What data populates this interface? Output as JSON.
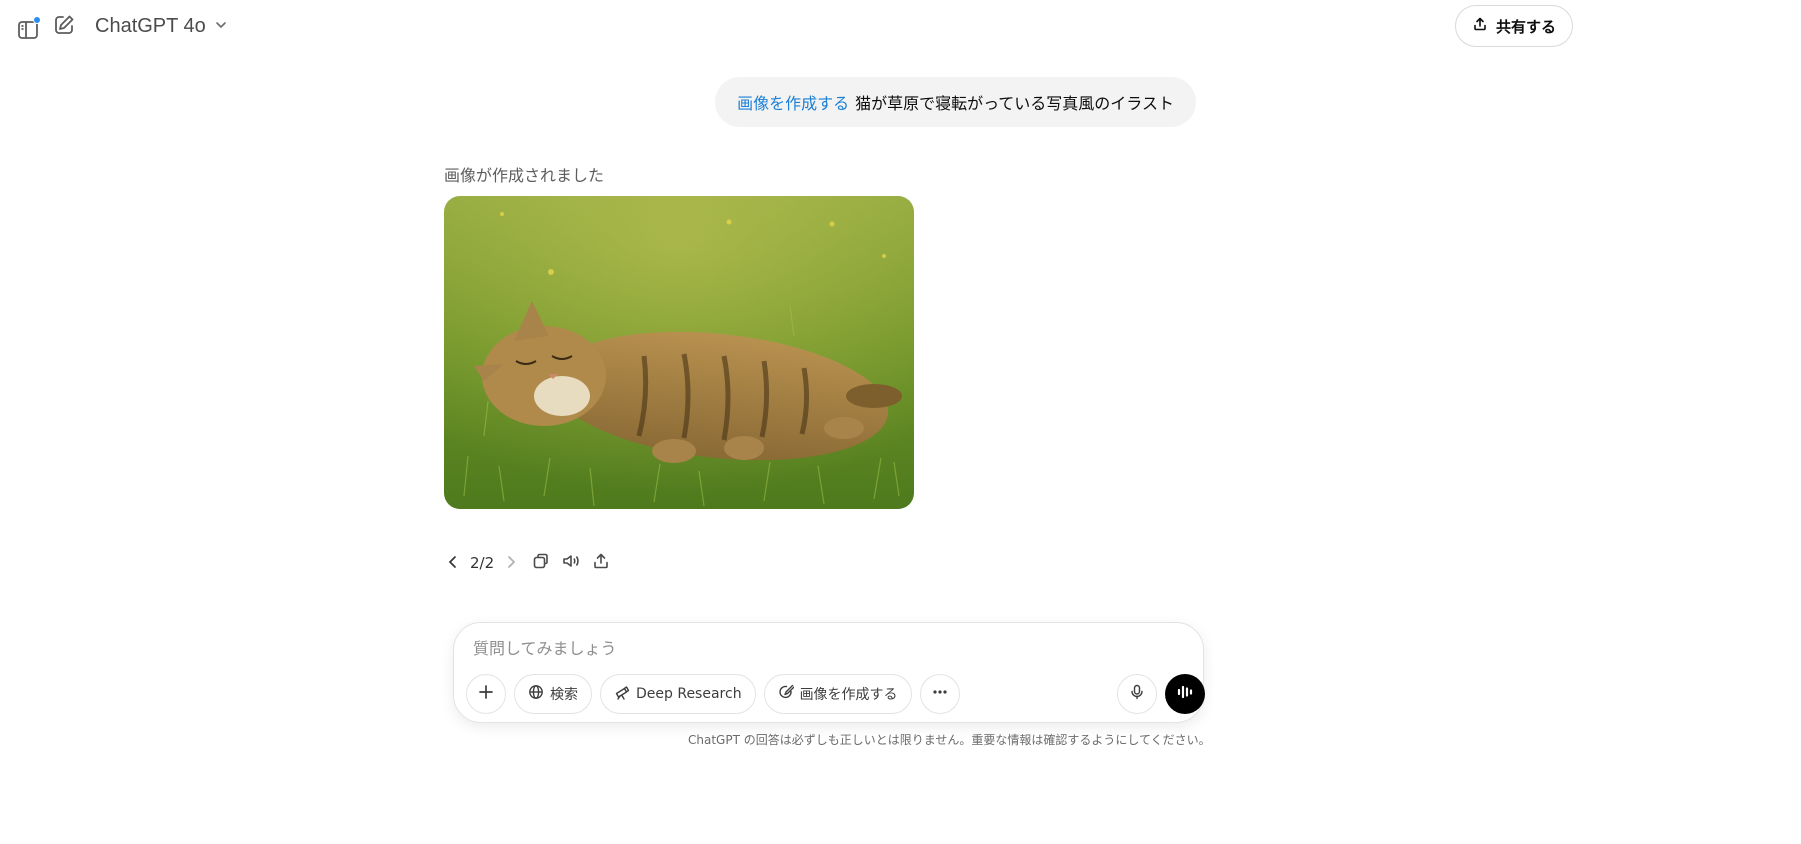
{
  "header": {
    "model_name": "ChatGPT 4o",
    "share_label": "共有する"
  },
  "conversation": {
    "user_message": {
      "tool_tag": "画像を作成する",
      "text": "猫が草原で寝転がっている写真風のイラスト"
    },
    "assistant": {
      "status": "画像が作成されました",
      "image_alt": "草原で寝転がるトラ猫"
    },
    "pager": "2/2"
  },
  "composer": {
    "placeholder": "質問してみましょう",
    "tools": {
      "search": "検索",
      "deep_research": "Deep Research",
      "create_image": "画像を作成する"
    },
    "footnote": "ChatGPT の回答は必ずしも正しいとは限りません。重要な情報は確認するようにしてください。"
  },
  "colors": {
    "accent": "#1a7fd6",
    "notification_dot": "#2a8ef0",
    "bubble_bg": "#f3f3f3"
  },
  "icons": {
    "sidebar": "sidebar-icon",
    "new_chat": "new-chat-icon",
    "share": "share-upload-icon",
    "prev": "chevron-left-icon",
    "next": "chevron-right-icon",
    "copy": "copy-icon",
    "read_aloud": "speaker-icon",
    "export": "upload-icon",
    "attach": "plus-icon",
    "search": "globe-icon",
    "deep_research": "telescope-icon",
    "create_image": "image-brush-icon",
    "more": "more-dots-icon",
    "mic": "microphone-icon",
    "voice": "voice-waveform-icon"
  }
}
